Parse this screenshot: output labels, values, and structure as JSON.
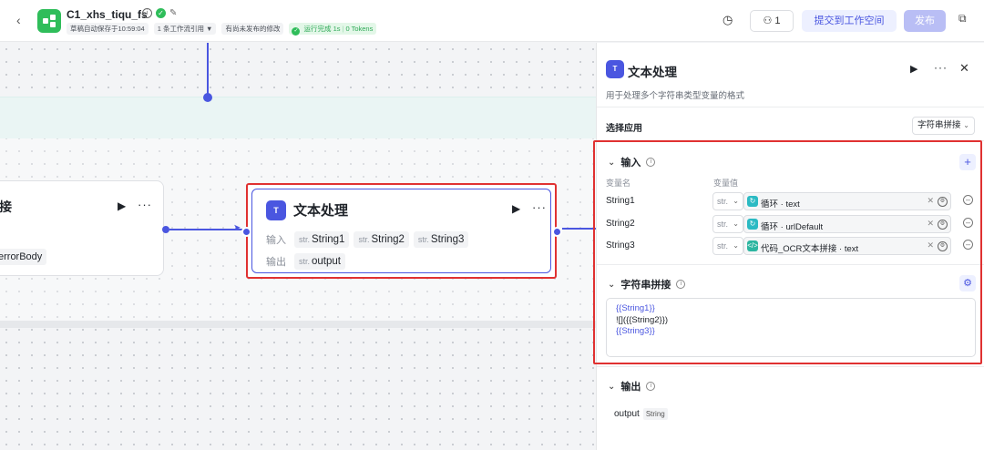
{
  "header": {
    "app_name": "C1_xhs_tiqu_fs",
    "autosave": "草稿自动保存于10:59:04",
    "refs": "1 条工作流引用",
    "unpublished": "有尚未发布的修改",
    "run_status": "运行完成 1s",
    "tokens": "0 Tokens",
    "users_count": "1",
    "submit_label": "提交到工作空间",
    "publish_label": "发布"
  },
  "canvas": {
    "left_node": {
      "title": "接",
      "chip": "errorBody"
    },
    "main_node": {
      "title": "文本处理",
      "icon_text": "T",
      "input_label": "输入",
      "output_label": "输出",
      "type_prefix": "str.",
      "inputs": [
        "String1",
        "String2",
        "String3"
      ],
      "output": "output"
    }
  },
  "panel": {
    "title": "文本处理",
    "description": "用于处理多个字符串类型变量的格式",
    "app_label": "选择应用",
    "app_value": "字符串拼接",
    "input_section": "输入",
    "col_name": "变量名",
    "col_value": "变量值",
    "inputs": [
      {
        "name": "String1",
        "type": "str.",
        "source": "循环",
        "field": "text"
      },
      {
        "name": "String2",
        "type": "str.",
        "source": "循环",
        "field": "urlDefault"
      },
      {
        "name": "String3",
        "type": "str.",
        "source": "代码_OCR文本拼接",
        "field": "text"
      }
    ],
    "concat_section": "字符串拼接",
    "concat_lines": [
      "{{String1}}",
      "![]({{String2}})",
      "{{String3}}"
    ],
    "output_section": "输出",
    "output_name": "output",
    "output_type": "String"
  },
  "colors": {
    "accent": "#4a56e0",
    "highlight_border": "#e03131",
    "success": "#2fbd5a"
  }
}
